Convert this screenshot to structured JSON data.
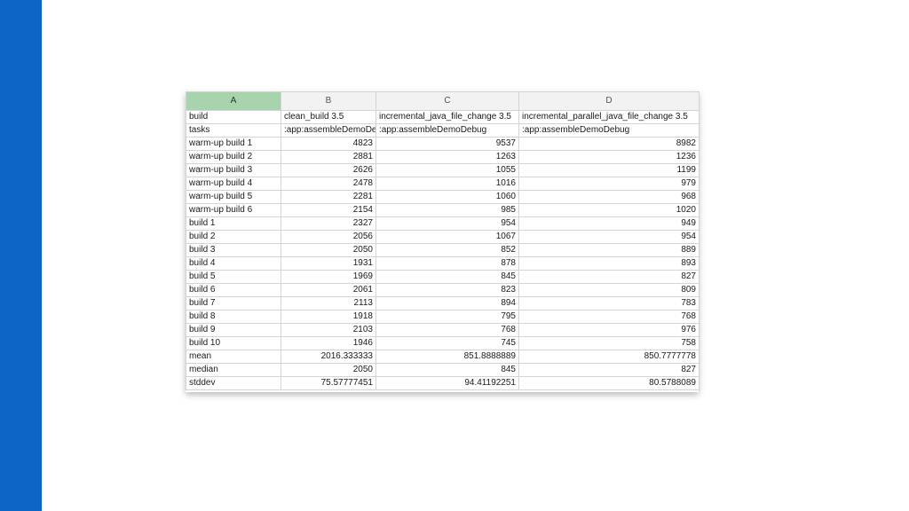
{
  "spreadsheet": {
    "column_headers": [
      "A",
      "B",
      "C",
      "D"
    ],
    "rows": [
      [
        "build",
        "clean_build 3.5",
        "incremental_java_file_change 3.5",
        "incremental_parallel_java_file_change 3.5"
      ],
      [
        "tasks",
        ":app:assembleDemoDebug",
        ":app:assembleDemoDebug",
        ":app:assembleDemoDebug"
      ],
      [
        "warm-up build 1",
        "4823",
        "9537",
        "8982"
      ],
      [
        "warm-up build 2",
        "2881",
        "1263",
        "1236"
      ],
      [
        "warm-up build 3",
        "2626",
        "1055",
        "1199"
      ],
      [
        "warm-up build 4",
        "2478",
        "1016",
        "979"
      ],
      [
        "warm-up build 5",
        "2281",
        "1060",
        "968"
      ],
      [
        "warm-up build 6",
        "2154",
        "985",
        "1020"
      ],
      [
        "build 1",
        "2327",
        "954",
        "949"
      ],
      [
        "build 2",
        "2056",
        "1067",
        "954"
      ],
      [
        "build 3",
        "2050",
        "852",
        "889"
      ],
      [
        "build 4",
        "1931",
        "878",
        "893"
      ],
      [
        "build 5",
        "1969",
        "845",
        "827"
      ],
      [
        "build 6",
        "2061",
        "823",
        "809"
      ],
      [
        "build 7",
        "2113",
        "894",
        "783"
      ],
      [
        "build 8",
        "1918",
        "795",
        "768"
      ],
      [
        "build 9",
        "2103",
        "768",
        "976"
      ],
      [
        "build 10",
        "1946",
        "745",
        "758"
      ],
      [
        "mean",
        "2016.333333",
        "851.8888889",
        "850.7777778"
      ],
      [
        "median",
        "2050",
        "845",
        "827"
      ],
      [
        "stddev",
        "75.57777451",
        "94.41192251",
        "80.5788089"
      ]
    ]
  },
  "colors": {
    "left_bar": "#0a66c2",
    "selected_header": "#a7d3ad",
    "header_bg": "#f2f2f2",
    "grid": "#d4d4d4"
  }
}
